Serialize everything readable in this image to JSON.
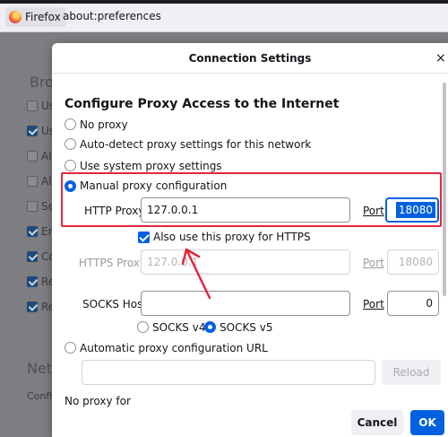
{
  "browser": {
    "identity": "Firefox",
    "url": "about:preferences"
  },
  "background_page": {
    "heading_partial": "Bro",
    "checkbox_labels": [
      "Us",
      "Us",
      "Al",
      "Al",
      "Se",
      "En",
      "Co",
      "Re",
      "Re"
    ],
    "network_heading": "Netw",
    "config_text": "Confi"
  },
  "dialog": {
    "title": "Connection Settings",
    "close_glyph": "×",
    "heading": "Configure Proxy Access to the Internet",
    "options": {
      "no_proxy": "No proxy",
      "auto_detect": "Auto-detect proxy settings for this network",
      "system": "Use system proxy settings",
      "manual": "Manual proxy configuration",
      "auto_url": "Automatic proxy configuration URL"
    },
    "selected_option": "manual",
    "http": {
      "label": "HTTP Proxy",
      "value": "127.0.0.1",
      "port_label": "Port",
      "port_value": "18080"
    },
    "also_https": {
      "label": "Also use this proxy for HTTPS",
      "checked": true
    },
    "https": {
      "label": "HTTPS Proxy",
      "value": "127.0.0.1",
      "port_label": "Port",
      "port_value": "18080"
    },
    "socks": {
      "label": "SOCKS Host",
      "value": "",
      "port_label": "Port",
      "port_value": "0"
    },
    "socks_versions": {
      "v4": "SOCKS v4",
      "v5": "SOCKS v5",
      "selected": "v5"
    },
    "auto_url_value": "",
    "reload_label": "Reload",
    "no_proxy_for": "No proxy for",
    "cancel_label": "Cancel",
    "ok_label": "OK"
  },
  "colors": {
    "accent": "#0061e0",
    "highlight": "#e3263a"
  }
}
